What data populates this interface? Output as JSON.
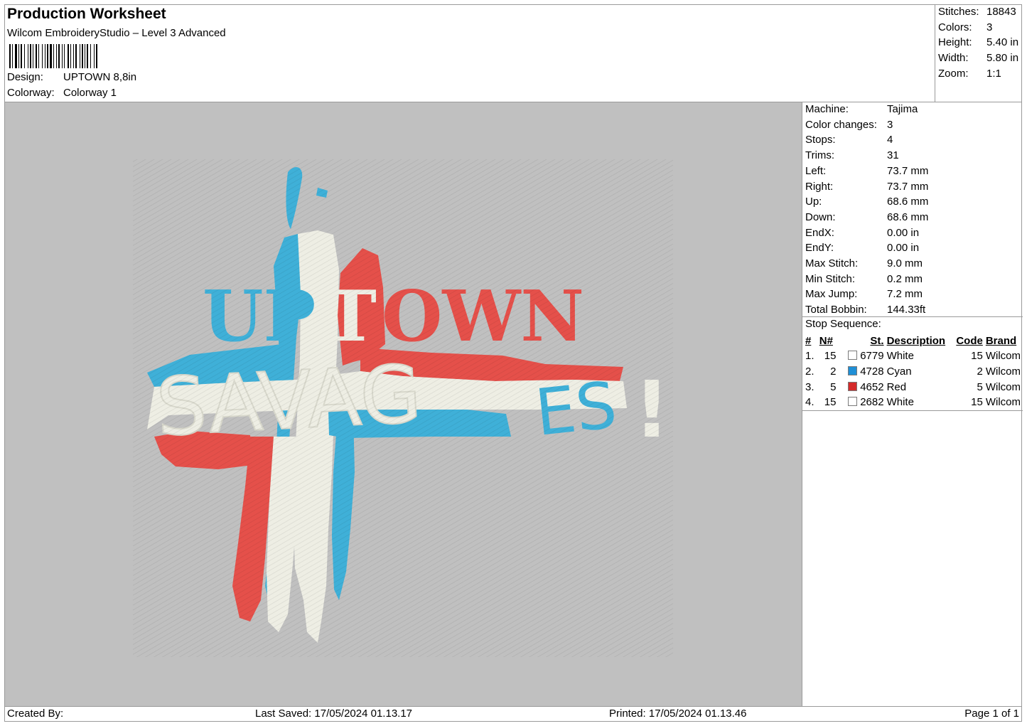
{
  "header": {
    "title": "Production Worksheet",
    "subtitle": "Wilcom EmbroideryStudio – Level 3 Advanced",
    "design_label": "Design:",
    "design_value": "UPTOWN 8,8in",
    "colorway_label": "Colorway:",
    "colorway_value": "Colorway 1"
  },
  "stats": [
    {
      "label": "Stitches:",
      "value": "18843"
    },
    {
      "label": "Colors:",
      "value": "3"
    },
    {
      "label": "Height:",
      "value": "5.40 in"
    },
    {
      "label": "Width:",
      "value": "5.80 in"
    },
    {
      "label": "Zoom:",
      "value": "1:1"
    }
  ],
  "machine": [
    {
      "label": "Machine:",
      "value": "Tajima"
    },
    {
      "label": "Color changes:",
      "value": "3"
    },
    {
      "label": "Stops:",
      "value": "4"
    },
    {
      "label": "Trims:",
      "value": "31"
    },
    {
      "label": "Left:",
      "value": "73.7 mm"
    },
    {
      "label": "Right:",
      "value": "73.7 mm"
    },
    {
      "label": "Up:",
      "value": "68.6 mm"
    },
    {
      "label": "Down:",
      "value": "68.6 mm"
    },
    {
      "label": "EndX:",
      "value": "0.00 in"
    },
    {
      "label": "EndY:",
      "value": "0.00 in"
    },
    {
      "label": "Max Stitch:",
      "value": "9.0 mm"
    },
    {
      "label": "Min Stitch:",
      "value": "0.2 mm"
    },
    {
      "label": "Max Jump:",
      "value": "7.2 mm"
    },
    {
      "label": "Total Bobbin:",
      "value": "144.33ft"
    }
  ],
  "stop_sequence": {
    "title": "Stop Sequence:",
    "headers": [
      "#",
      "N#",
      "St.",
      "Description",
      "Code",
      "Brand"
    ],
    "rows": [
      {
        "idx": "1.",
        "n": "15",
        "color": "#ffffff",
        "st": "6779",
        "desc": "White",
        "code": "15",
        "brand": "Wilcom"
      },
      {
        "idx": "2.",
        "n": "2",
        "color": "#1f8fd6",
        "st": "4728",
        "desc": "Cyan",
        "code": "2",
        "brand": "Wilcom"
      },
      {
        "idx": "3.",
        "n": "5",
        "color": "#d42a2a",
        "st": "4652",
        "desc": "Red",
        "code": "5",
        "brand": "Wilcom"
      },
      {
        "idx": "4.",
        "n": "15",
        "color": "#ffffff",
        "st": "2682",
        "desc": "White",
        "code": "15",
        "brand": "Wilcom"
      }
    ]
  },
  "design_artwork": {
    "line1": "UPTOWN",
    "line2": "SAVAGES!",
    "colors": {
      "cyan": "#3fb0d8",
      "red": "#e5504a",
      "white": "#eeeee4"
    }
  },
  "footer": {
    "created_by": "Created By:",
    "last_saved": "Last Saved: 17/05/2024 01.13.17",
    "printed": "Printed: 17/05/2024 01.13.46",
    "page": "Page 1 of 1"
  }
}
